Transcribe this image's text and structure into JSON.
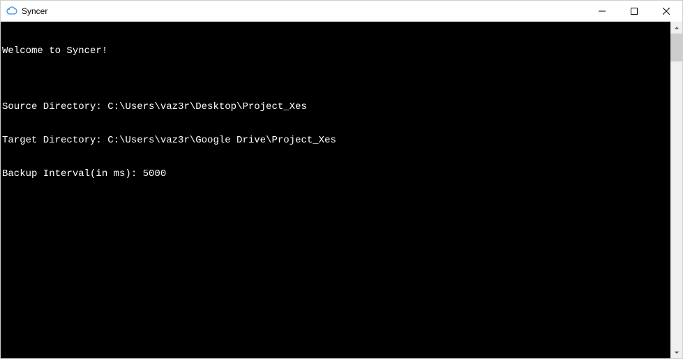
{
  "window": {
    "title": "Syncer"
  },
  "console": {
    "lines": [
      "Welcome to Syncer!",
      "",
      "Source Directory: C:\\Users\\vaz3r\\Desktop\\Project_Xes",
      "Target Directory: C:\\Users\\vaz3r\\Google Drive\\Project_Xes",
      "Backup Interval(in ms): 5000"
    ]
  }
}
